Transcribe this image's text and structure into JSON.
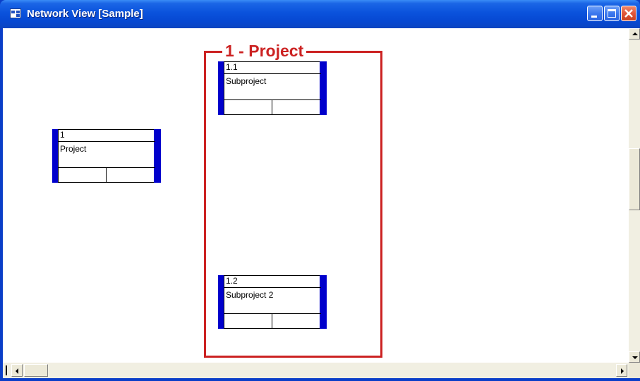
{
  "window": {
    "title": "Network View [Sample]"
  },
  "summary_task": {
    "label": "1 - Project",
    "border_color": "#cc2222"
  },
  "nodes": [
    {
      "id": "1",
      "name": "Project"
    },
    {
      "id": "1.1",
      "name": "Subproject"
    },
    {
      "id": "1.2",
      "name": "Subproject 2"
    }
  ],
  "colors": {
    "titlebar": "#0a52dc",
    "node_bar": "#0000cc",
    "summary": "#cc2222"
  },
  "icons": {
    "app": "network-view-icon",
    "minimize": "minimize-icon",
    "maximize": "maximize-icon",
    "close": "close-icon"
  }
}
